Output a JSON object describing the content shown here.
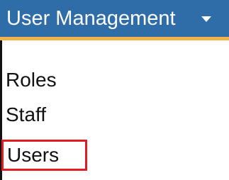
{
  "menu": {
    "title": "User Management",
    "caret_icon": "chevron-down-icon",
    "items": [
      {
        "label": "Roles"
      },
      {
        "label": "Staff"
      },
      {
        "label": "Users",
        "highlighted": true
      }
    ]
  },
  "colors": {
    "header_background": "#2f6da9",
    "header_accent": "#f0b34a",
    "highlight_border": "#e31b23",
    "text": "#111111"
  }
}
